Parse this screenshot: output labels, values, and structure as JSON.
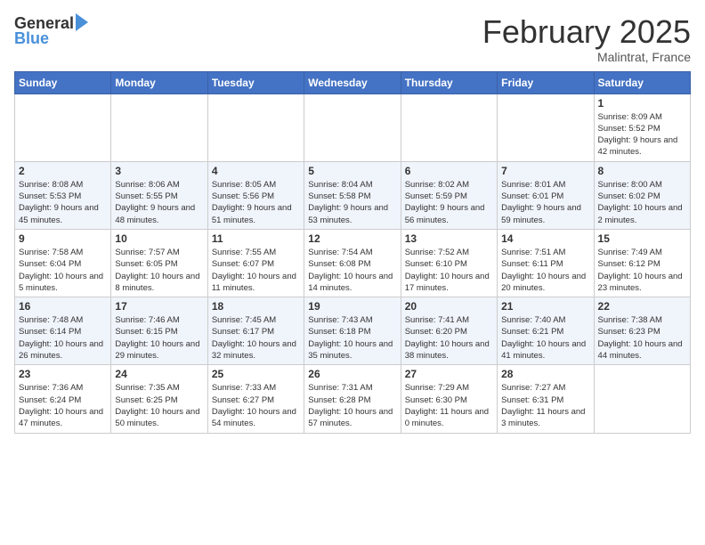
{
  "header": {
    "logo_general": "General",
    "logo_blue": "Blue",
    "month_title": "February 2025",
    "location": "Malintrat, France"
  },
  "weekdays": [
    "Sunday",
    "Monday",
    "Tuesday",
    "Wednesday",
    "Thursday",
    "Friday",
    "Saturday"
  ],
  "weeks": [
    [
      {
        "day": "",
        "info": ""
      },
      {
        "day": "",
        "info": ""
      },
      {
        "day": "",
        "info": ""
      },
      {
        "day": "",
        "info": ""
      },
      {
        "day": "",
        "info": ""
      },
      {
        "day": "",
        "info": ""
      },
      {
        "day": "1",
        "info": "Sunrise: 8:09 AM\nSunset: 5:52 PM\nDaylight: 9 hours and 42 minutes."
      }
    ],
    [
      {
        "day": "2",
        "info": "Sunrise: 8:08 AM\nSunset: 5:53 PM\nDaylight: 9 hours and 45 minutes."
      },
      {
        "day": "3",
        "info": "Sunrise: 8:06 AM\nSunset: 5:55 PM\nDaylight: 9 hours and 48 minutes."
      },
      {
        "day": "4",
        "info": "Sunrise: 8:05 AM\nSunset: 5:56 PM\nDaylight: 9 hours and 51 minutes."
      },
      {
        "day": "5",
        "info": "Sunrise: 8:04 AM\nSunset: 5:58 PM\nDaylight: 9 hours and 53 minutes."
      },
      {
        "day": "6",
        "info": "Sunrise: 8:02 AM\nSunset: 5:59 PM\nDaylight: 9 hours and 56 minutes."
      },
      {
        "day": "7",
        "info": "Sunrise: 8:01 AM\nSunset: 6:01 PM\nDaylight: 9 hours and 59 minutes."
      },
      {
        "day": "8",
        "info": "Sunrise: 8:00 AM\nSunset: 6:02 PM\nDaylight: 10 hours and 2 minutes."
      }
    ],
    [
      {
        "day": "9",
        "info": "Sunrise: 7:58 AM\nSunset: 6:04 PM\nDaylight: 10 hours and 5 minutes."
      },
      {
        "day": "10",
        "info": "Sunrise: 7:57 AM\nSunset: 6:05 PM\nDaylight: 10 hours and 8 minutes."
      },
      {
        "day": "11",
        "info": "Sunrise: 7:55 AM\nSunset: 6:07 PM\nDaylight: 10 hours and 11 minutes."
      },
      {
        "day": "12",
        "info": "Sunrise: 7:54 AM\nSunset: 6:08 PM\nDaylight: 10 hours and 14 minutes."
      },
      {
        "day": "13",
        "info": "Sunrise: 7:52 AM\nSunset: 6:10 PM\nDaylight: 10 hours and 17 minutes."
      },
      {
        "day": "14",
        "info": "Sunrise: 7:51 AM\nSunset: 6:11 PM\nDaylight: 10 hours and 20 minutes."
      },
      {
        "day": "15",
        "info": "Sunrise: 7:49 AM\nSunset: 6:12 PM\nDaylight: 10 hours and 23 minutes."
      }
    ],
    [
      {
        "day": "16",
        "info": "Sunrise: 7:48 AM\nSunset: 6:14 PM\nDaylight: 10 hours and 26 minutes."
      },
      {
        "day": "17",
        "info": "Sunrise: 7:46 AM\nSunset: 6:15 PM\nDaylight: 10 hours and 29 minutes."
      },
      {
        "day": "18",
        "info": "Sunrise: 7:45 AM\nSunset: 6:17 PM\nDaylight: 10 hours and 32 minutes."
      },
      {
        "day": "19",
        "info": "Sunrise: 7:43 AM\nSunset: 6:18 PM\nDaylight: 10 hours and 35 minutes."
      },
      {
        "day": "20",
        "info": "Sunrise: 7:41 AM\nSunset: 6:20 PM\nDaylight: 10 hours and 38 minutes."
      },
      {
        "day": "21",
        "info": "Sunrise: 7:40 AM\nSunset: 6:21 PM\nDaylight: 10 hours and 41 minutes."
      },
      {
        "day": "22",
        "info": "Sunrise: 7:38 AM\nSunset: 6:23 PM\nDaylight: 10 hours and 44 minutes."
      }
    ],
    [
      {
        "day": "23",
        "info": "Sunrise: 7:36 AM\nSunset: 6:24 PM\nDaylight: 10 hours and 47 minutes."
      },
      {
        "day": "24",
        "info": "Sunrise: 7:35 AM\nSunset: 6:25 PM\nDaylight: 10 hours and 50 minutes."
      },
      {
        "day": "25",
        "info": "Sunrise: 7:33 AM\nSunset: 6:27 PM\nDaylight: 10 hours and 54 minutes."
      },
      {
        "day": "26",
        "info": "Sunrise: 7:31 AM\nSunset: 6:28 PM\nDaylight: 10 hours and 57 minutes."
      },
      {
        "day": "27",
        "info": "Sunrise: 7:29 AM\nSunset: 6:30 PM\nDaylight: 11 hours and 0 minutes."
      },
      {
        "day": "28",
        "info": "Sunrise: 7:27 AM\nSunset: 6:31 PM\nDaylight: 11 hours and 3 minutes."
      },
      {
        "day": "",
        "info": ""
      }
    ]
  ]
}
